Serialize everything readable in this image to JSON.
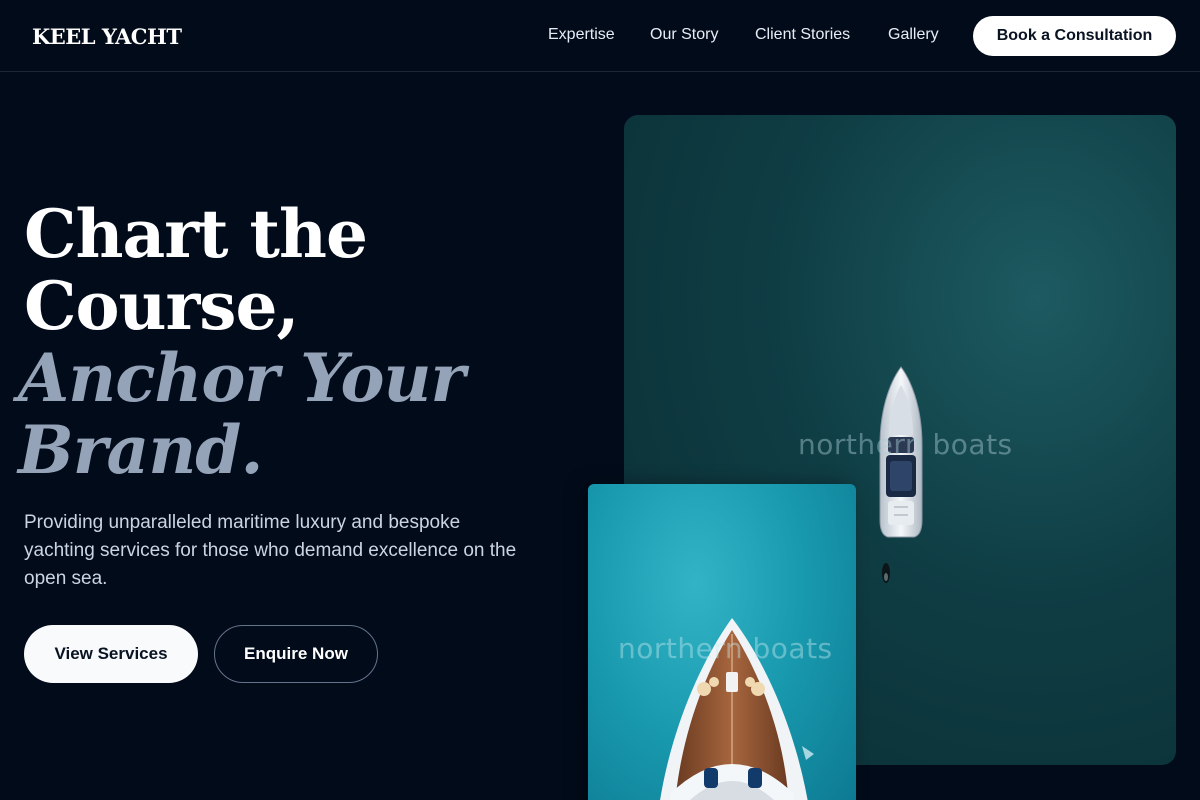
{
  "brand": {
    "logo": "KEEL YACHT"
  },
  "nav": {
    "links": [
      "Expertise",
      "Our Story",
      "Client Stories",
      "Gallery"
    ],
    "cta": "Book a Consultation"
  },
  "hero": {
    "headline_lines": [
      "Chart the",
      "Course,"
    ],
    "headline_italic_lines": [
      "Anchor Your",
      "Brand."
    ],
    "subtext": "Providing unparalleled maritime luxury and bespoke yachting services for those who demand excellence on the open sea.",
    "primary_button": "View Services",
    "secondary_button": "Enquire Now"
  },
  "images": {
    "main_watermark": "northern boats",
    "small_watermark": "northern boats"
  },
  "colors": {
    "background": "#020b1a",
    "accent_text": "#94a3b8",
    "button_light": "#f8fafc"
  }
}
